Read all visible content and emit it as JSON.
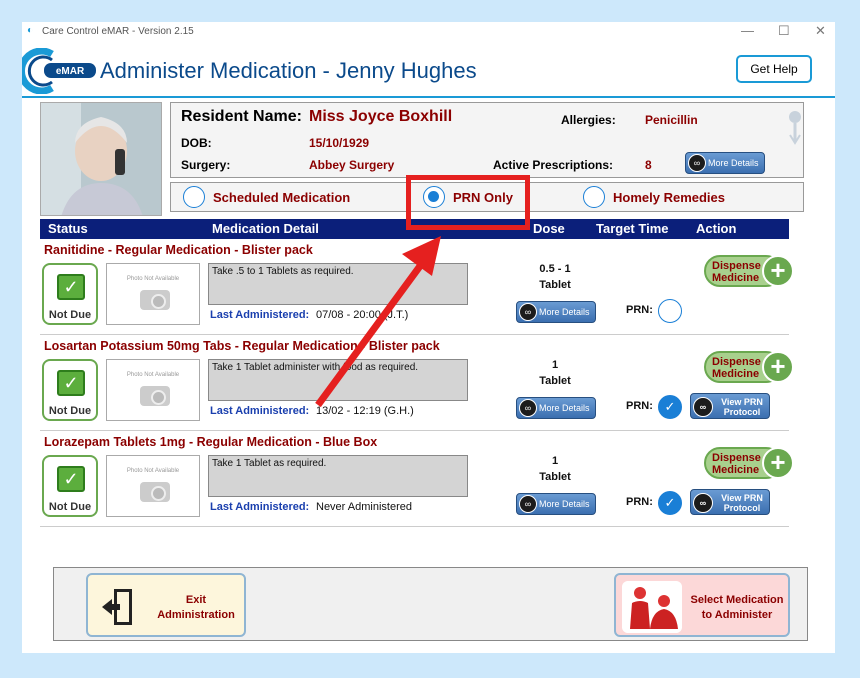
{
  "window": {
    "title": "Care Control eMAR - Version 2.15",
    "controls": {
      "minimize": "—",
      "maximize": "☐",
      "close": "✕"
    }
  },
  "header": {
    "logo_badge": "eMAR",
    "title": "Administer Medication - Jenny Hughes",
    "help_label": "Get Help"
  },
  "resident": {
    "name_label": "Resident Name:",
    "name": "Miss Joyce Boxhill",
    "dob_label": "DOB:",
    "dob": "15/10/1929",
    "surgery_label": "Surgery:",
    "surgery": "Abbey Surgery",
    "allergies_label": "Allergies:",
    "allergies": "Penicillin",
    "prescriptions_label": "Active Prescriptions:",
    "prescriptions": "8",
    "more_details": "More Details"
  },
  "filters": {
    "scheduled": "Scheduled Medication",
    "prn": "PRN Only",
    "homely": "Homely Remedies",
    "selected": "prn"
  },
  "table": {
    "headers": {
      "status": "Status",
      "detail": "Medication Detail",
      "dose": "Dose",
      "target": "Target Time",
      "action": "Action"
    }
  },
  "common": {
    "status": "Not Due",
    "photo_caption": "Photo Not Available",
    "last_label": "Last Administered:",
    "more_details": "More Details",
    "prn_label": "PRN:",
    "dispense": "Dispense",
    "medicine": "Medicine",
    "view_prn_1": "View PRN",
    "view_prn_2": "Protocol"
  },
  "medications": [
    {
      "title": "Ranitidine - Regular Medication - Blister pack",
      "instructions": "Take .5 to 1 Tablets as required.",
      "last_administered": "07/08 - 20:00 (J.T.)",
      "dose_amount": "0.5 - 1",
      "dose_unit": "Tablet",
      "prn_checked": false
    },
    {
      "title": "Losartan Potassium 50mg Tabs - Regular Medication - Blister pack",
      "instructions": "Take 1 Tablet administer with food as required.",
      "last_administered": "13/02 - 12:19 (G.H.)",
      "dose_amount": "1",
      "dose_unit": "Tablet",
      "prn_checked": true
    },
    {
      "title": "Lorazepam Tablets 1mg - Regular Medication - Blue Box",
      "instructions": "Take 1 Tablet as required.",
      "last_administered": "Never Administered",
      "dose_amount": "1",
      "dose_unit": "Tablet",
      "prn_checked": true
    }
  ],
  "footer": {
    "exit_line1": "Exit",
    "exit_line2": "Administration",
    "select_line1": "Select Medication",
    "select_line2": "to Administer"
  },
  "colors": {
    "accent": "#1a9ad6",
    "title": "#0b4a8b",
    "resident_value": "#8b0000",
    "table_header": "#0b1f7a",
    "status_green": "#6aa84f",
    "annotation_red": "#e5201f"
  }
}
